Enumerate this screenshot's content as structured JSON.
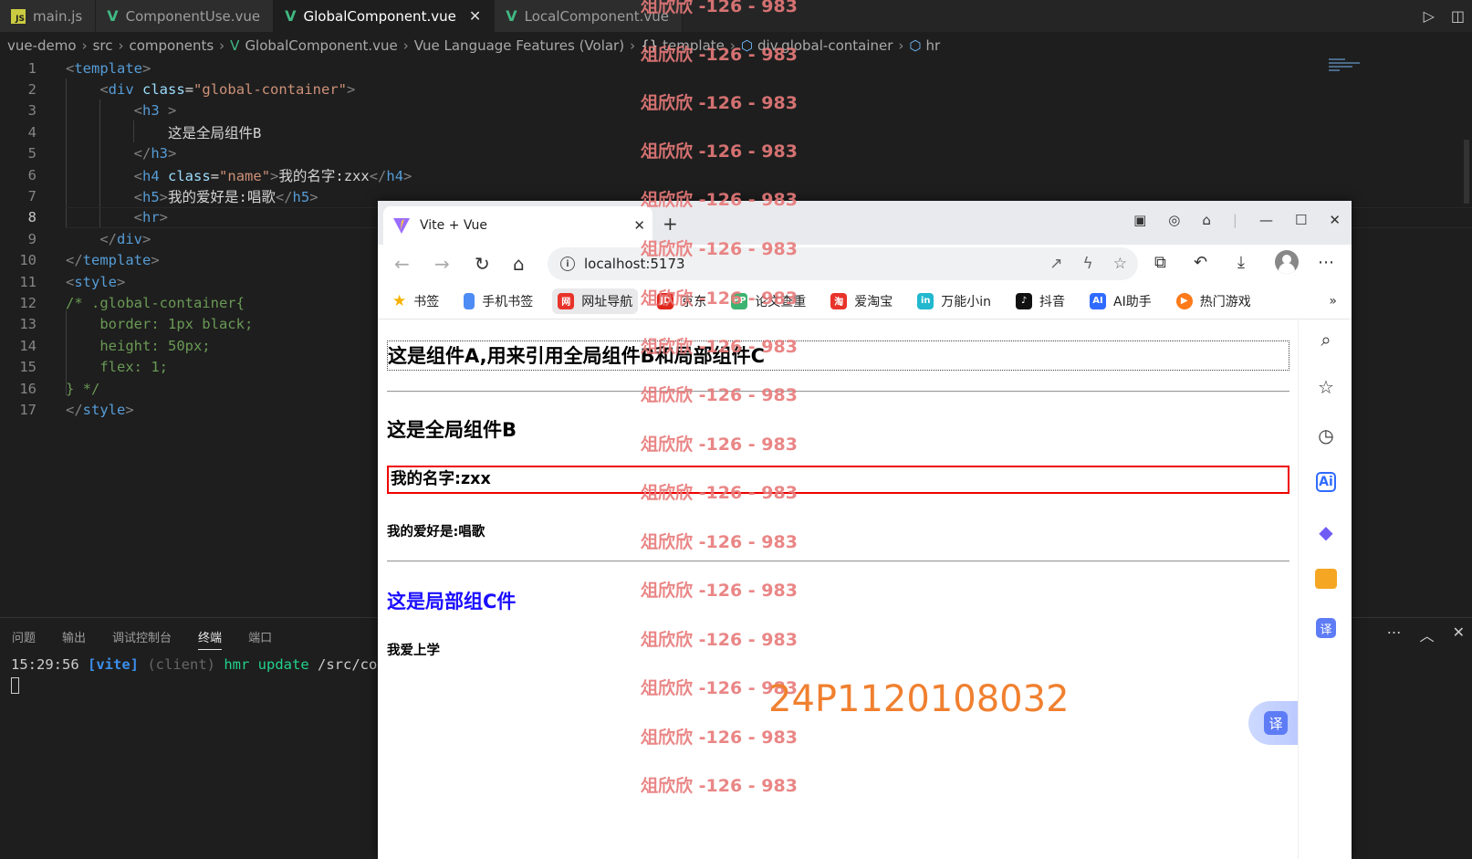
{
  "editor": {
    "tabs": [
      {
        "label": "main.js",
        "icon": "js-file-icon"
      },
      {
        "label": "ComponentUse.vue",
        "icon": "vue-file-icon"
      },
      {
        "label": "GlobalComponent.vue",
        "icon": "vue-file-icon",
        "active": true
      },
      {
        "label": "LocalComponent.vue",
        "icon": "vue-file-icon"
      }
    ],
    "breadcrumb": [
      "vue-demo",
      "src",
      "components",
      "GlobalComponent.vue",
      "Vue Language Features (Volar)",
      "template",
      "div.global-container",
      "hr"
    ],
    "line_numbers": [
      "1",
      "2",
      "3",
      "4",
      "5",
      "6",
      "7",
      "8",
      "9",
      "10",
      "11",
      "12",
      "13",
      "14",
      "15",
      "16",
      "17"
    ],
    "code": {
      "l1_tag": "template",
      "l2_tag": "div",
      "l2_attr": "class",
      "l2_val": "\"global-container\"",
      "l3_tag": "h3",
      "l4_text": "这是全局组件B",
      "l5_tag": "h3",
      "l6_tag": "h4",
      "l6_attr": "class",
      "l6_val": "\"name\"",
      "l6_text": "我的名字:zxx",
      "l6_close": "h4",
      "l7_tag": "h5",
      "l7_text": "我的爱好是:唱歌",
      "l7_close": "h5",
      "l8_tag": "hr",
      "l9_tag": "div",
      "l10_tag": "template",
      "l11_tag": "style",
      "l12": "/* .global-container{",
      "l13": "    border: 1px black;",
      "l14": "    height: 50px;",
      "l15": "    flex: 1;",
      "l16": "} */",
      "l17_tag": "style"
    }
  },
  "panel": {
    "tabs": [
      "问题",
      "输出",
      "调试控制台",
      "终端",
      "端口"
    ],
    "active_tab": "终端",
    "terminal": {
      "time": "15:29:56",
      "tag": "[vite]",
      "client": "(client)",
      "hmr": "hmr update",
      "path": "/src/compo"
    }
  },
  "browser": {
    "tab_title": "Vite + Vue",
    "url": "localhost:5173",
    "bookmarks": [
      "书签",
      "手机书签",
      "网址导航",
      "京东",
      "论文查重",
      "爱淘宝",
      "万能小in",
      "抖音",
      "AI助手",
      "热门游戏"
    ],
    "page": {
      "component_a": "这是组件A,用来引用全局组件B和局部组件C",
      "global_b": "这是全局组件B",
      "name": "我的名字:zxx",
      "hobby": "我的爱好是:唱歌",
      "local_c": "这是局部组C件",
      "school": "我爱上学"
    },
    "translate_label": "译"
  },
  "watermark": {
    "text": "俎欣欣 -126 - 983",
    "id": "24P1120108032"
  },
  "colors": {
    "vue_green": "#41b883",
    "tag_blue": "#569cd6",
    "string_orange": "#ce9178",
    "comment_green": "#6a9955",
    "highlight_red_border": "#ee0000",
    "local_c_blue": "#1a0dff",
    "watermark_red": "#e87a7a",
    "watermark_orange": "#f08030"
  }
}
